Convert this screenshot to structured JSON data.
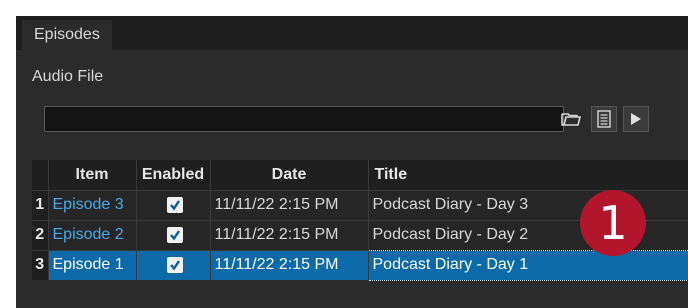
{
  "tabs": [
    {
      "label": "Episodes"
    }
  ],
  "panel": {
    "label": "Audio File"
  },
  "audio_file": {
    "value": ""
  },
  "toolbar": {
    "folder_icon": "folder-open-icon",
    "list_icon": "list-icon",
    "play_icon": "play-icon"
  },
  "table": {
    "columns": [
      "Item",
      "Enabled",
      "Date",
      "Title"
    ],
    "rows": [
      {
        "num": "1",
        "item": "Episode 3",
        "enabled": true,
        "date": "11/11/22 2:15 PM",
        "title": "Podcast Diary - Day 3"
      },
      {
        "num": "2",
        "item": "Episode 2",
        "enabled": true,
        "date": "11/11/22 2:15 PM",
        "title": "Podcast Diary - Day 2"
      },
      {
        "num": "3",
        "item": "Episode 1",
        "enabled": true,
        "date": "11/11/22 2:15 PM",
        "title": "Podcast Diary - Day 1",
        "selected": true
      }
    ]
  },
  "badge": {
    "number": "1"
  },
  "colors": {
    "link": "#46a9e8",
    "selection": "#0c6aa8",
    "badge": "#b3162c"
  }
}
